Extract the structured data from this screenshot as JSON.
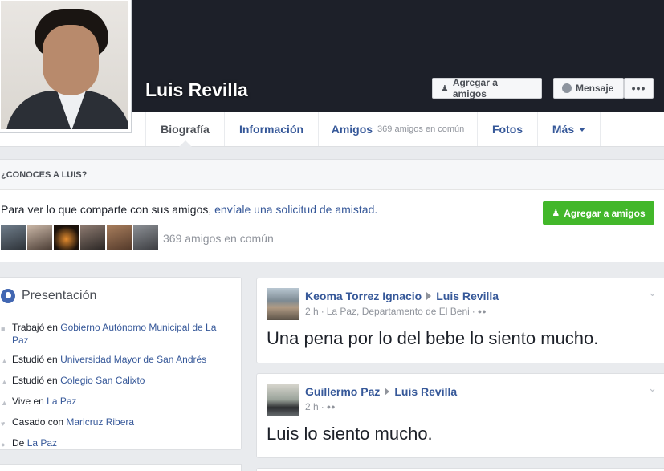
{
  "profile": {
    "name": "Luis Revilla",
    "add_friend_label": "Agregar a amigos",
    "message_label": "Mensaje",
    "more_label": "•••"
  },
  "nav": {
    "tabs": [
      {
        "label": "Biografía"
      },
      {
        "label": "Información"
      },
      {
        "label": "Amigos",
        "sub": "369 amigos en común"
      },
      {
        "label": "Fotos"
      },
      {
        "label": "Más"
      }
    ]
  },
  "know": {
    "heading": "¿CONOCES A LUIS?",
    "text": "Para ver lo que comparte con sus amigos,",
    "link": "envíale una solicitud de amistad.",
    "button_label": "Agregar a amigos",
    "mutual": "369 amigos en común"
  },
  "intro": {
    "title": "Presentación",
    "items": [
      {
        "prefix": "Trabajó en",
        "link": "Gobierno Autónomo Municipal de La Paz"
      },
      {
        "prefix": "Estudió en",
        "link": "Universidad Mayor de San Andrés"
      },
      {
        "prefix": "Estudió en",
        "link": "Colegio San Calixto"
      },
      {
        "prefix": "Vive en",
        "link": "La Paz"
      },
      {
        "prefix": "Casado con",
        "link": "Maricruz Ribera"
      },
      {
        "prefix": "De",
        "link": "La Paz"
      }
    ]
  },
  "posts": [
    {
      "author": "Keoma Torrez Ignacio",
      "target": "Luis Revilla",
      "time": "2 h",
      "location": "La Paz, Departamento de El Beni",
      "body": "Una pena por lo del bebe lo siento mucho."
    },
    {
      "author": "Guillermo Paz",
      "target": "Luis Revilla",
      "time": "2 h",
      "location": "",
      "body": "Luis lo siento mucho."
    }
  ],
  "colors": {
    "cover": "#1d2029",
    "link": "#365899",
    "green_button": "#42b72a"
  }
}
